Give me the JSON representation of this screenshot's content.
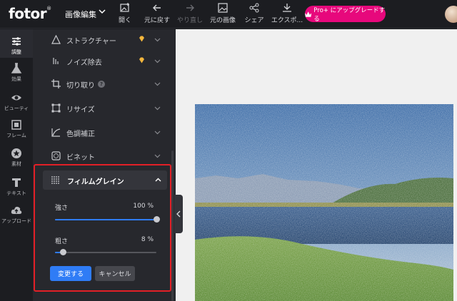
{
  "topbar": {
    "logo": "fotor",
    "logo_mark": "®",
    "menu_title": "画像編集",
    "tools": [
      {
        "label": "開く",
        "icon": "image-plus-icon"
      },
      {
        "label": "元に戻す",
        "icon": "arrow-left-icon"
      },
      {
        "label": "やり直し",
        "icon": "arrow-right-icon"
      },
      {
        "label": "元の画像",
        "icon": "image-icon"
      },
      {
        "label": "シェア",
        "icon": "share-icon"
      },
      {
        "label": "エクスポ...",
        "icon": "download-icon"
      }
    ],
    "pro_button": "Pro+ にアップグレードする"
  },
  "rail": {
    "items": [
      {
        "label": "調整",
        "icon": "sliders-icon",
        "active": true
      },
      {
        "label": "効果",
        "icon": "flask-icon"
      },
      {
        "label": "ビューティ",
        "icon": "eye-icon"
      },
      {
        "label": "フレーム",
        "icon": "frame-icon"
      },
      {
        "label": "素材",
        "icon": "star-icon"
      },
      {
        "label": "テキスト",
        "icon": "text-icon"
      },
      {
        "label": "アップロード",
        "icon": "cloud-upload-icon"
      }
    ]
  },
  "panel": {
    "items": [
      {
        "label": "ストラクチャー",
        "premium": true
      },
      {
        "label": "ノイズ除去",
        "premium": true
      },
      {
        "label": "切り取り",
        "help": "?"
      },
      {
        "label": "リサイズ"
      },
      {
        "label": "色調補正"
      },
      {
        "label": "ビネット"
      }
    ],
    "film_grain": {
      "title": "フィルムグレイン",
      "intensity_label": "強さ",
      "intensity_value": "100 %",
      "intensity": 1.0,
      "coarseness_label": "粗さ",
      "coarseness_value": "8 %",
      "coarseness": 0.08,
      "apply_label": "変更する",
      "cancel_label": "キャンセル"
    }
  },
  "colors": {
    "accent": "#2f7cf6",
    "pro": "#e7087c",
    "highlight_border": "#e21f26",
    "premium_gem": "#f3b63c"
  }
}
